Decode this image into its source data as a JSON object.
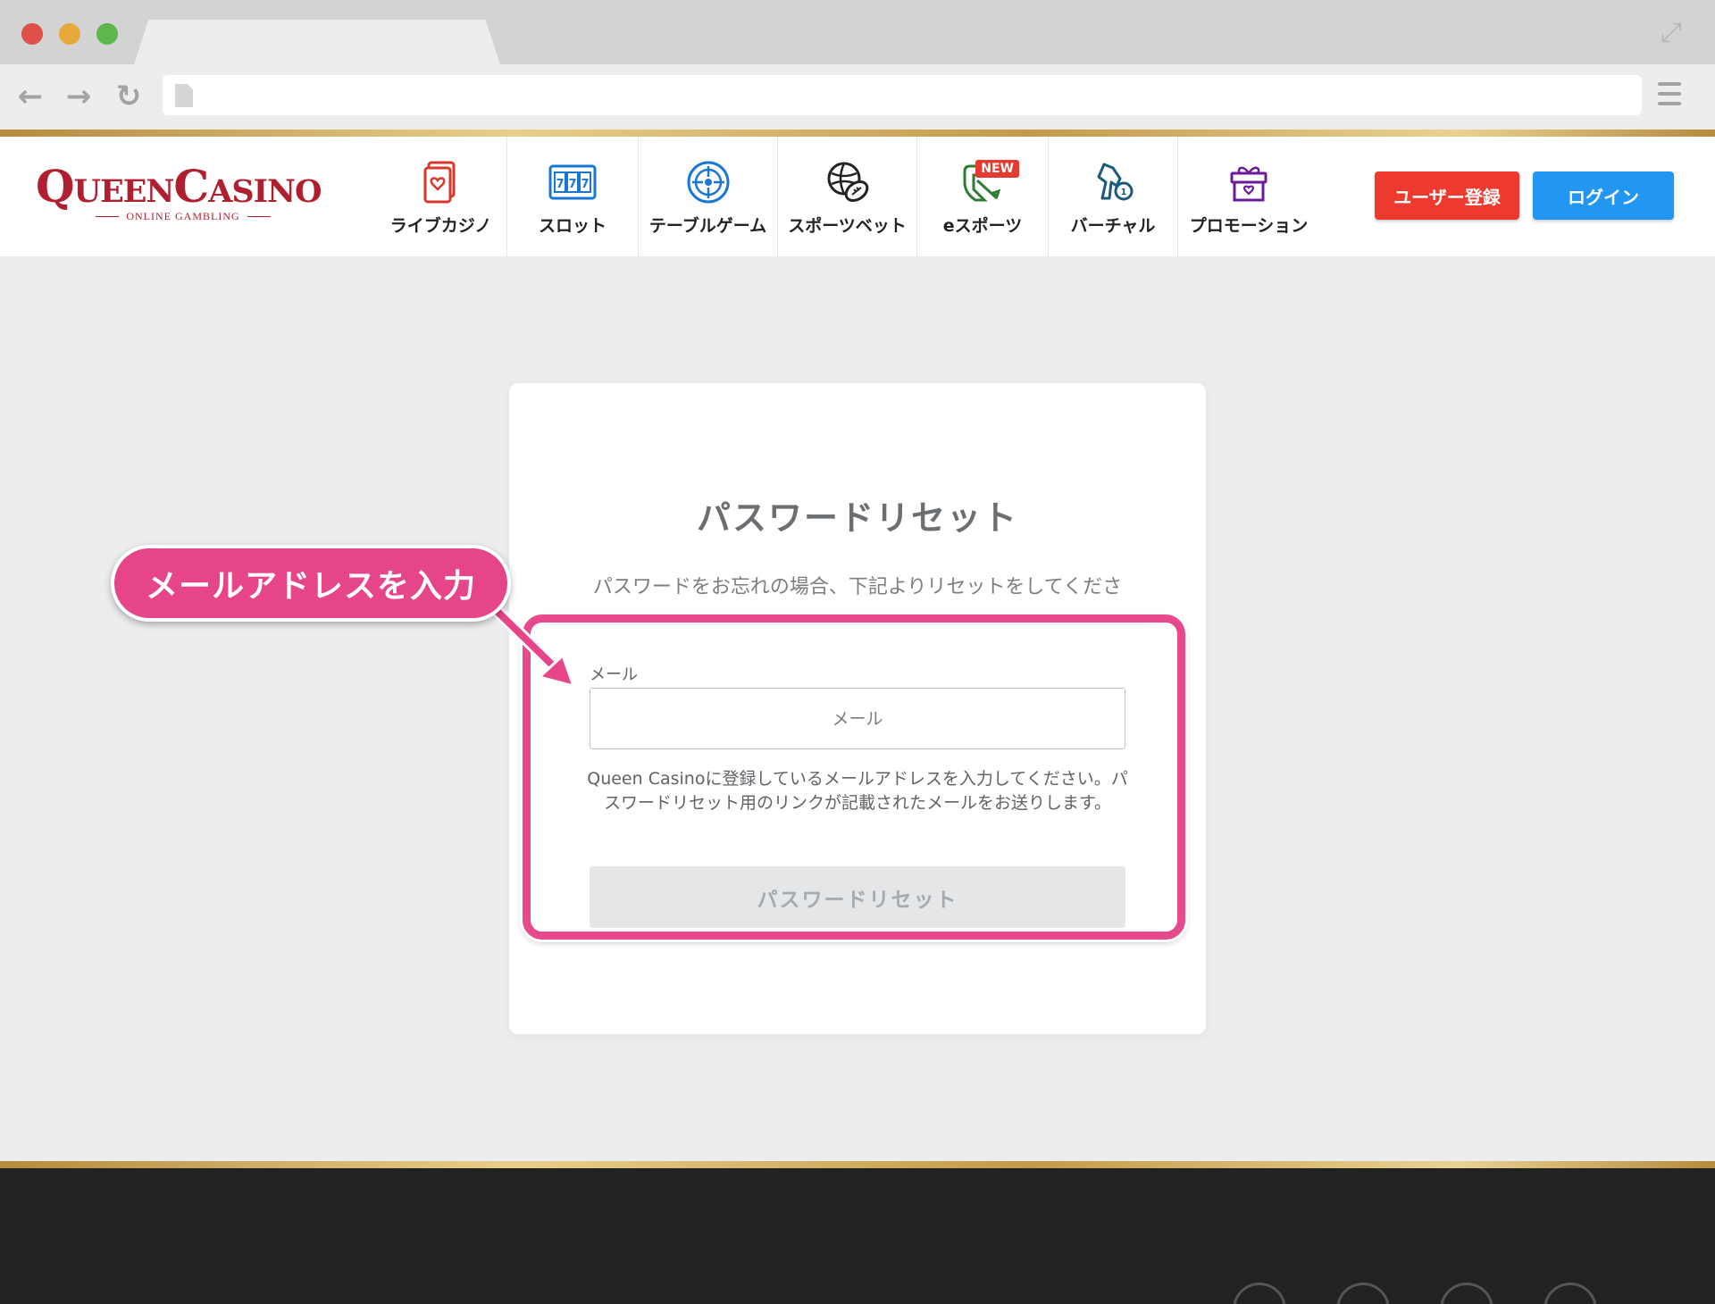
{
  "browser": {
    "url": "",
    "back_glyph": "←",
    "forward_glyph": "→",
    "reload_glyph": "↻",
    "expand_glyph": "⤢"
  },
  "header": {
    "logo_main": "QueenCasino",
    "logo_sub": "ONLINE GAMBLING",
    "nav": [
      {
        "label": "ライブカジノ",
        "icon": "card-heart-icon"
      },
      {
        "label": "スロット",
        "icon": "slot-777-icon"
      },
      {
        "label": "テーブルゲーム",
        "icon": "roulette-icon"
      },
      {
        "label": "スポーツベット",
        "icon": "sports-ball-icon"
      },
      {
        "label": "eスポーツ",
        "icon": "esports-icon",
        "badge": "NEW"
      },
      {
        "label": "バーチャル",
        "icon": "virtual-horse-icon"
      },
      {
        "label": "プロモーション",
        "icon": "gift-icon"
      }
    ],
    "register_label": "ユーザー登録",
    "login_label": "ログイン"
  },
  "reset_form": {
    "title": "パスワードリセット",
    "description": "パスワードをお忘れの場合、下記よりリセットをしてください。",
    "email_label": "メール",
    "email_placeholder": "メール",
    "email_value": "",
    "help_text": "Queen Casinoに登録しているメールアドレスを入力してください。パスワードリセット用のリンクが記載されたメールをお送りします。",
    "submit_label": "パスワードリセット"
  },
  "annotation": {
    "callout_text": "メールアドレスを入力"
  },
  "colors": {
    "brand_red": "#b01f2f",
    "register_red": "#ee3a2e",
    "login_blue": "#2196f3",
    "annotation_pink": "#e6458a",
    "gold": "#c49a4a"
  }
}
